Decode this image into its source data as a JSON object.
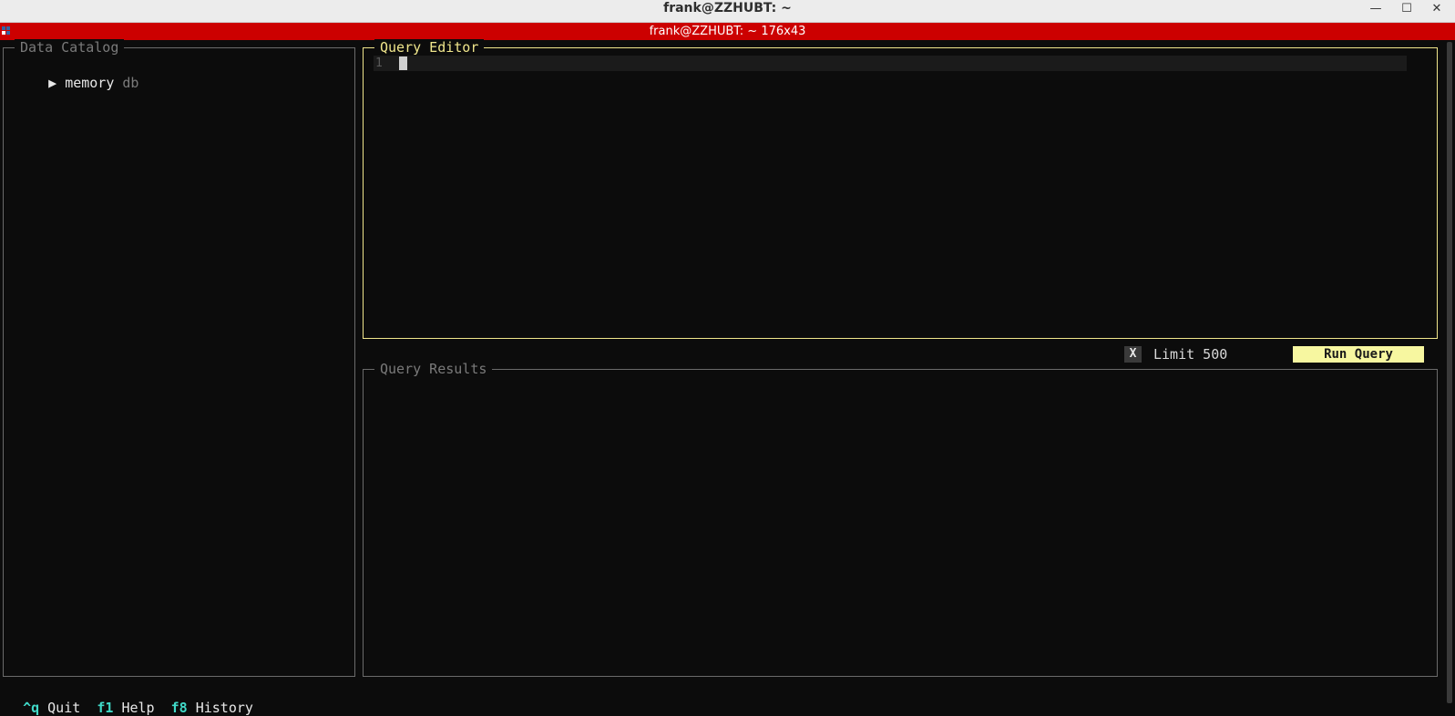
{
  "window": {
    "title": "frank@ZZHUBT: ~",
    "minimize_glyph": "—",
    "maximize_glyph": "☐",
    "close_glyph": "✕"
  },
  "terminal": {
    "header_title": "frank@ZZHUBT: ~ 176x43"
  },
  "catalog": {
    "title": "Data Catalog",
    "items": [
      {
        "expander": "▶",
        "name": "memory",
        "type": "db"
      }
    ]
  },
  "editor": {
    "title": "Query Editor",
    "line_number": "1",
    "content": ""
  },
  "controls": {
    "limit_toggle_label": "X",
    "limit_label": "Limit 500",
    "run_button_label": "Run Query"
  },
  "results": {
    "title": "Query Results"
  },
  "footer": {
    "shortcuts": [
      {
        "key": "^q",
        "label": "Quit"
      },
      {
        "key": "f1",
        "label": "Help"
      },
      {
        "key": "f8",
        "label": "History"
      }
    ]
  },
  "colors": {
    "background": "#0c0c0c",
    "accent": "#f0e68c",
    "terminal_header": "#cc0000",
    "footer_key": "#40d9c8"
  }
}
